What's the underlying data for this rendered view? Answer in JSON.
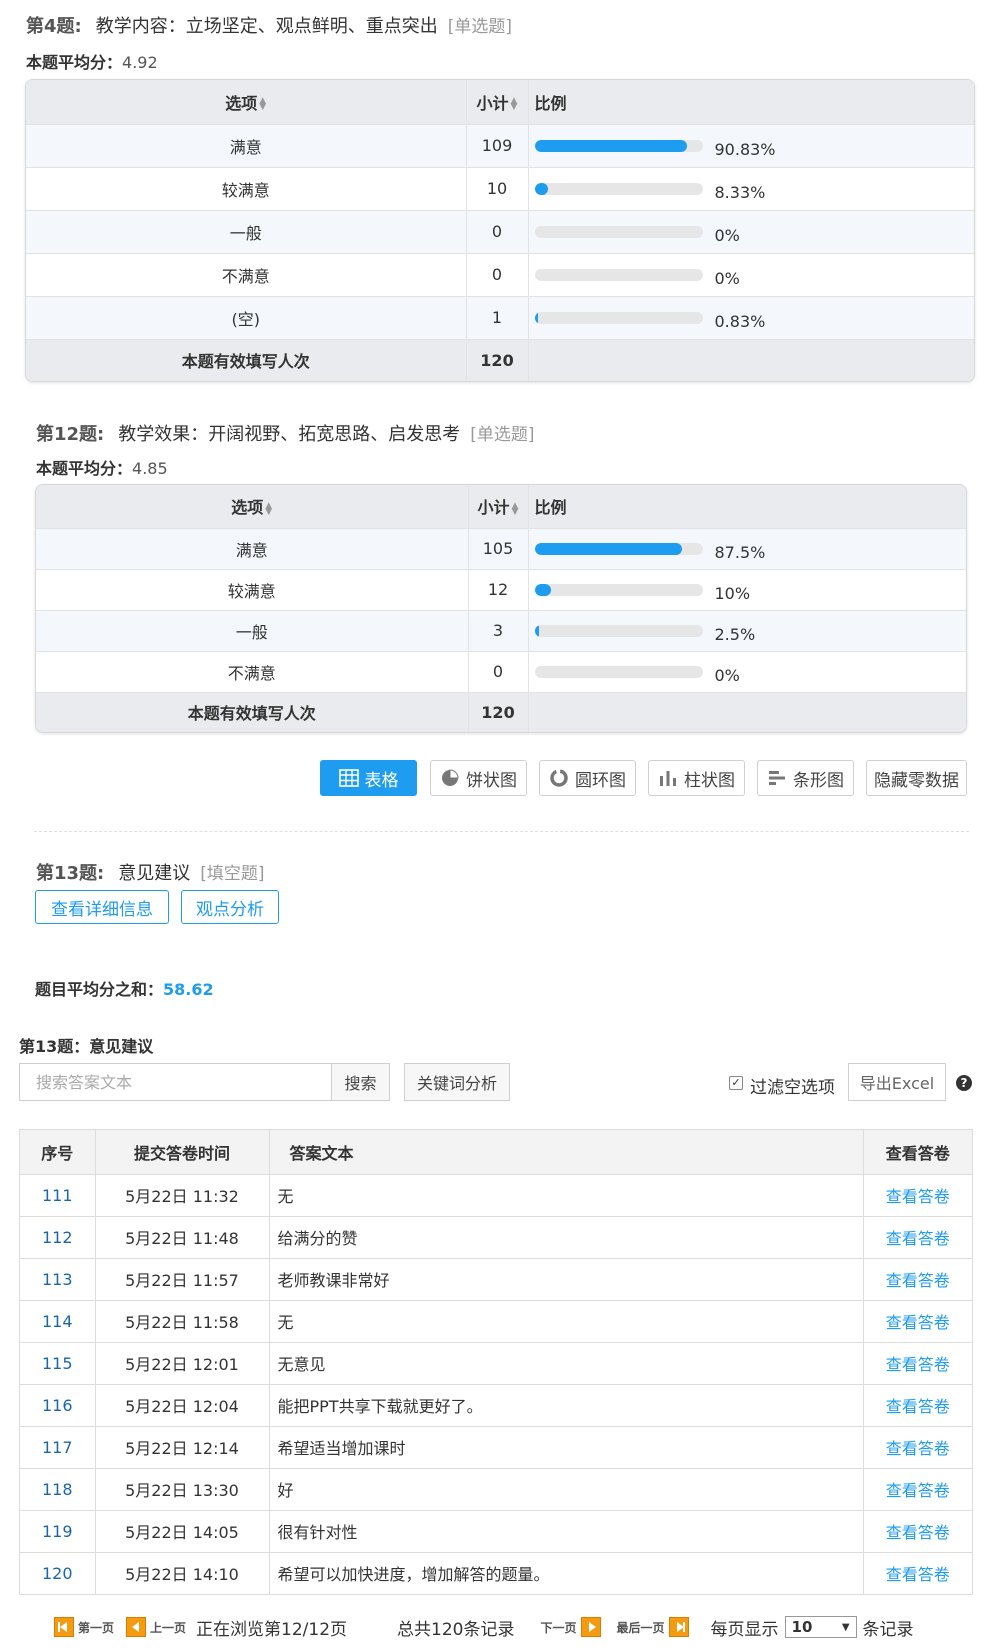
{
  "q4": {
    "number": "第4题:",
    "title": "教学内容：立场坚定、观点鲜明、重点突出",
    "type": "[单选题]",
    "avg_label": "本题平均分：",
    "avg_value": "4.92",
    "headers": {
      "option": "选项",
      "count": "小计",
      "ratio": "比例"
    },
    "rows": [
      {
        "option": "满意",
        "count": "109",
        "pct": "90.83%",
        "value": 90.83
      },
      {
        "option": "较满意",
        "count": "10",
        "pct": "8.33%",
        "value": 8.33
      },
      {
        "option": "一般",
        "count": "0",
        "pct": "0%",
        "value": 0
      },
      {
        "option": "不满意",
        "count": "0",
        "pct": "0%",
        "value": 0
      },
      {
        "option": "(空)",
        "count": "1",
        "pct": "0.83%",
        "value": 0.83
      }
    ],
    "total_label": "本题有效填写人次",
    "total_value": "120"
  },
  "q12": {
    "number": "第12题:",
    "title": "教学效果：开阔视野、拓宽思路、启发思考",
    "type": "[单选题]",
    "avg_label": "本题平均分：",
    "avg_value": "4.85",
    "headers": {
      "option": "选项",
      "count": "小计",
      "ratio": "比例"
    },
    "rows": [
      {
        "option": "满意",
        "count": "105",
        "pct": "87.5%",
        "value": 87.5
      },
      {
        "option": "较满意",
        "count": "12",
        "pct": "10%",
        "value": 10
      },
      {
        "option": "一般",
        "count": "3",
        "pct": "2.5%",
        "value": 2.5
      },
      {
        "option": "不满意",
        "count": "0",
        "pct": "0%",
        "value": 0
      }
    ],
    "total_label": "本题有效填写人次",
    "total_value": "120"
  },
  "chart_buttons": {
    "table": "表格",
    "pie": "饼状图",
    "ring": "圆环图",
    "column": "柱状图",
    "bar": "条形图",
    "hide_zero": "隐藏零数据"
  },
  "q13": {
    "number": "第13题:",
    "title": "意见建议",
    "type": "[填空题]",
    "detail_btn": "查看详细信息",
    "analysis_btn": "观点分析"
  },
  "summary": {
    "label": "题目平均分之和：",
    "value": "58.62"
  },
  "answers": {
    "title": "第13题：意见建议",
    "search_placeholder": "搜索答案文本",
    "search_btn": "搜索",
    "keyword_btn": "关键词分析",
    "filter_label": "过滤空选项",
    "filter_checked": true,
    "export_btn": "导出Excel",
    "help": "?",
    "headers": {
      "seq": "序号",
      "time": "提交答卷时间",
      "text": "答案文本",
      "view": "查看答卷"
    },
    "rows": [
      {
        "seq": "111",
        "time": "5月22日 11:32",
        "text": "无",
        "view": "查看答卷"
      },
      {
        "seq": "112",
        "time": "5月22日 11:48",
        "text": "给满分的赞",
        "view": "查看答卷"
      },
      {
        "seq": "113",
        "time": "5月22日 11:57",
        "text": "老师教课非常好",
        "view": "查看答卷"
      },
      {
        "seq": "114",
        "time": "5月22日 11:58",
        "text": "无",
        "view": "查看答卷"
      },
      {
        "seq": "115",
        "time": "5月22日 12:01",
        "text": "无意见",
        "view": "查看答卷"
      },
      {
        "seq": "116",
        "time": "5月22日 12:04",
        "text": "能把PPT共享下载就更好了。",
        "view": "查看答卷"
      },
      {
        "seq": "117",
        "time": "5月22日 12:14",
        "text": "希望适当增加课时",
        "view": "查看答卷"
      },
      {
        "seq": "118",
        "time": "5月22日 13:30",
        "text": "好",
        "view": "查看答卷"
      },
      {
        "seq": "119",
        "time": "5月22日 14:05",
        "text": "很有针对性",
        "view": "查看答卷"
      },
      {
        "seq": "120",
        "time": "5月22日 14:10",
        "text": "希望可以加快进度，增加解答的题量。",
        "view": "查看答卷"
      }
    ]
  },
  "pager": {
    "first": "第一页",
    "prev": "上一页",
    "browsing": "正在浏览第12/12页",
    "total": "总共120条记录",
    "next": "下一页",
    "last": "最后一页",
    "per_page_label": "每页显示",
    "per_page_value": "10",
    "records_label": "条记录"
  }
}
